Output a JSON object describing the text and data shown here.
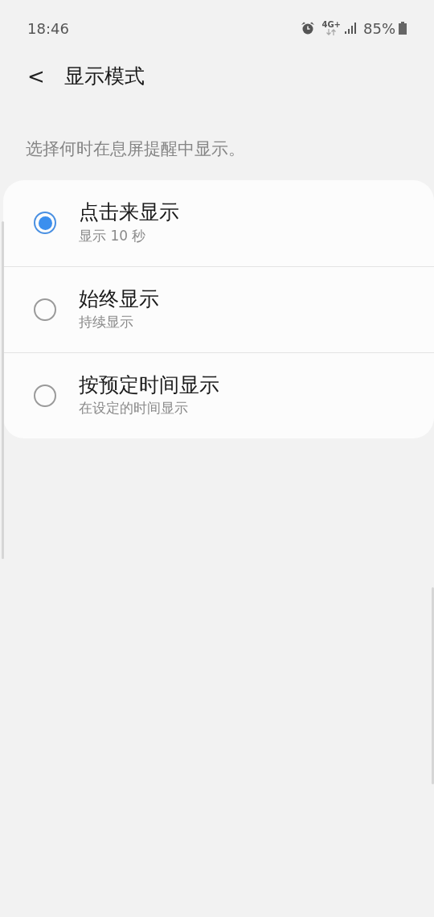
{
  "status_bar": {
    "time": "18:46",
    "network": "4G+",
    "battery": "85%"
  },
  "header": {
    "back": "<",
    "title": "显示模式"
  },
  "description": "选择何时在息屏提醒中显示。",
  "options": [
    {
      "title": "点击来显示",
      "subtitle": "显示 10 秒",
      "selected": true
    },
    {
      "title": "始终显示",
      "subtitle": "持续显示",
      "selected": false
    },
    {
      "title": "按预定时间显示",
      "subtitle": "在设定的时间显示",
      "selected": false
    }
  ]
}
